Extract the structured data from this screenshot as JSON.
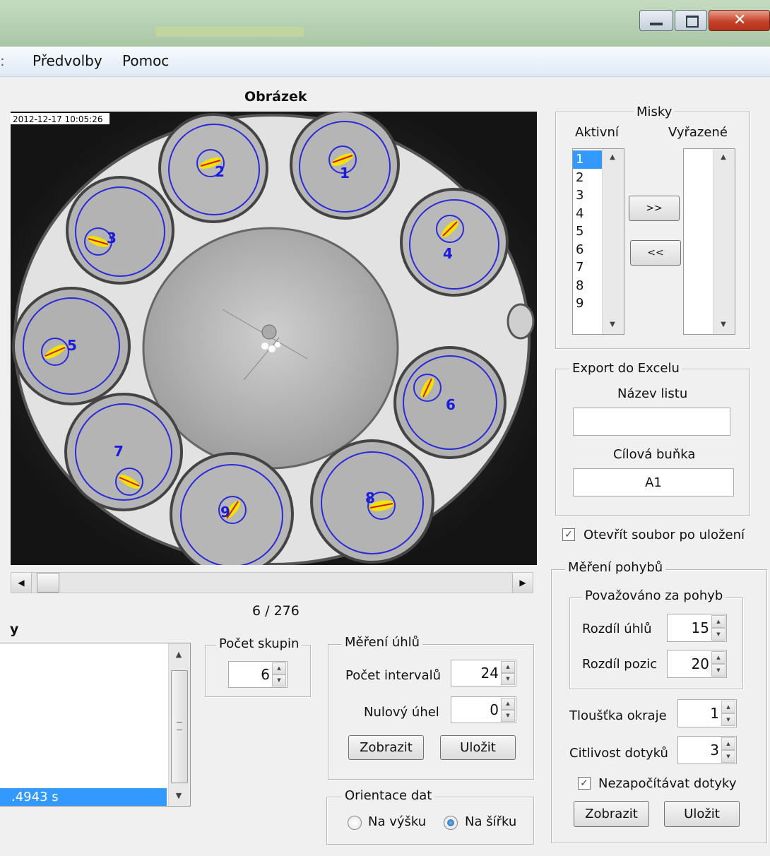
{
  "window": {
    "min_icon": "minimize-icon",
    "max_icon": "maximize-icon",
    "close_icon": "close-icon"
  },
  "menu": {
    "items": [
      "Předvolby",
      "Pomoc"
    ]
  },
  "image_panel": {
    "title": "Obrázek",
    "timestamp": "2012-12-17 10:05:26",
    "dish_labels": [
      "1",
      "2",
      "3",
      "4",
      "5",
      "6",
      "7",
      "8",
      "9"
    ],
    "frame_counter": "6 / 276"
  },
  "left_list": {
    "partial_title": "y",
    "selected_item": ".4943 s"
  },
  "group_count": {
    "title": "Počet skupin",
    "value": "6"
  },
  "angle_measure": {
    "title": "Měření úhlů",
    "interval_label": "Počet intervalů",
    "interval_value": "24",
    "zero_label": "Nulový úhel",
    "zero_value": "0",
    "show_button": "Zobrazit",
    "save_button": "Uložit"
  },
  "orientation": {
    "title": "Orientace dat",
    "vertical_label": "Na výšku",
    "horizontal_label": "Na šířku",
    "selected": "Na šířku"
  },
  "dishes": {
    "title": "Misky",
    "active_label": "Aktivní",
    "excluded_label": "Vyřazené",
    "active_items": [
      "1",
      "2",
      "3",
      "4",
      "5",
      "6",
      "7",
      "8",
      "9"
    ],
    "move_right_button": ">>",
    "move_left_button": "<<"
  },
  "excel_export": {
    "title": "Export do Excelu",
    "sheet_name_label": "Název listu",
    "sheet_name_value": "",
    "target_cell_label": "Cílová buňka",
    "target_cell_value": "A1",
    "open_after_save_label": "Otevřít soubor po uložení",
    "open_after_save_checked": true
  },
  "motion": {
    "title": "Měření pohybů",
    "sub_title": "Považováno za pohyb",
    "angle_diff_label": "Rozdíl úhlů",
    "angle_diff_value": "15",
    "pos_diff_label": "Rozdíl pozic",
    "pos_diff_value": "20",
    "edge_label": "Tloušťka okraje",
    "edge_value": "1",
    "sensitivity_label": "Citlivost dotyků",
    "sensitivity_value": "3",
    "ignore_touch_label": "Nezapočítávat dotyky",
    "ignore_touch_checked": true,
    "show_button": "Zobrazit",
    "save_button": "Uložit"
  },
  "colors": {
    "accent_blue": "#3399ff",
    "dish_outline": "#2a2ad8",
    "label_blue": "#1a1ae0",
    "larva_yellow": "#f2e400",
    "larva_red": "#d81818"
  }
}
